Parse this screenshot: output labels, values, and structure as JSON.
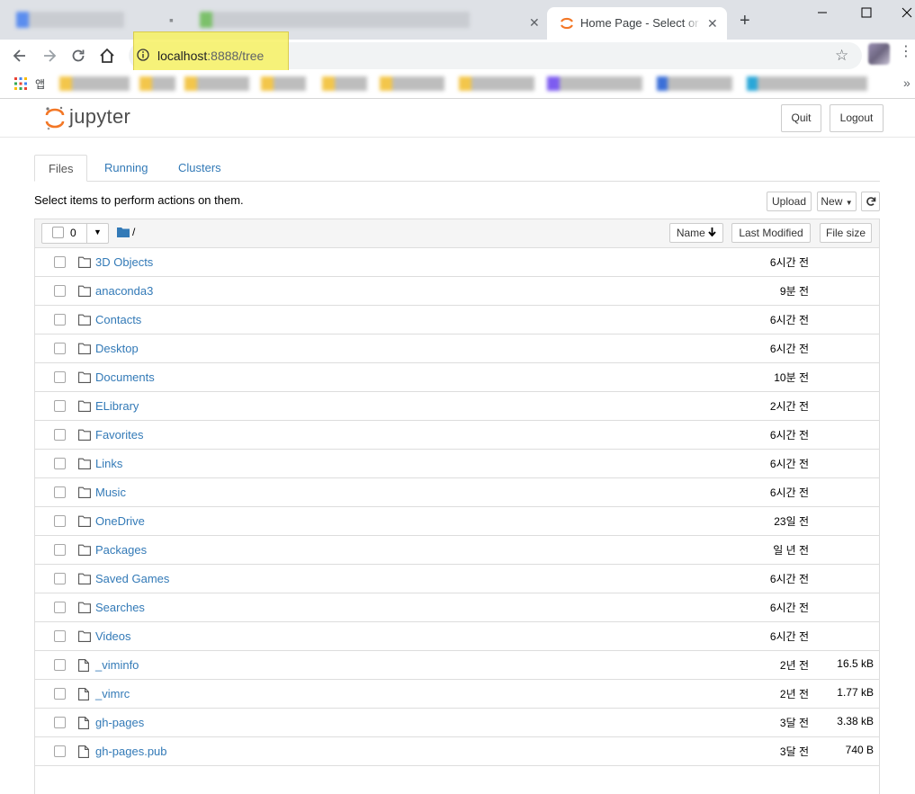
{
  "browser": {
    "active_tab_title": "Home Page - Select or create a notebook",
    "new_tab_glyph": "+",
    "close_glyph": "✕",
    "url_host": "localhost",
    "url_rest": ":8888/tree",
    "apps_label": "앱",
    "bookmarks_more": "»"
  },
  "header": {
    "logo_text": "jupyter",
    "quit_label": "Quit",
    "logout_label": "Logout"
  },
  "tabs": [
    {
      "label": "Files",
      "active": true
    },
    {
      "label": "Running",
      "active": false
    },
    {
      "label": "Clusters",
      "active": false
    }
  ],
  "toolbar": {
    "hint": "Select items to perform actions on them.",
    "upload_label": "Upload",
    "new_label": "New"
  },
  "listing": {
    "selected_count": "0",
    "breadcrumb": "/",
    "col_name": "Name",
    "col_modified": "Last Modified",
    "col_size": "File size",
    "items": [
      {
        "type": "folder",
        "name": "3D Objects",
        "modified": "6시간 전",
        "size": ""
      },
      {
        "type": "folder",
        "name": "anaconda3",
        "modified": "9분 전",
        "size": ""
      },
      {
        "type": "folder",
        "name": "Contacts",
        "modified": "6시간 전",
        "size": ""
      },
      {
        "type": "folder",
        "name": "Desktop",
        "modified": "6시간 전",
        "size": ""
      },
      {
        "type": "folder",
        "name": "Documents",
        "modified": "10분 전",
        "size": ""
      },
      {
        "type": "folder",
        "name": "ELibrary",
        "modified": "2시간 전",
        "size": ""
      },
      {
        "type": "folder",
        "name": "Favorites",
        "modified": "6시간 전",
        "size": ""
      },
      {
        "type": "folder",
        "name": "Links",
        "modified": "6시간 전",
        "size": ""
      },
      {
        "type": "folder",
        "name": "Music",
        "modified": "6시간 전",
        "size": ""
      },
      {
        "type": "folder",
        "name": "OneDrive",
        "modified": "23일 전",
        "size": ""
      },
      {
        "type": "folder",
        "name": "Packages",
        "modified": "일 년 전",
        "size": ""
      },
      {
        "type": "folder",
        "name": "Saved Games",
        "modified": "6시간 전",
        "size": ""
      },
      {
        "type": "folder",
        "name": "Searches",
        "modified": "6시간 전",
        "size": ""
      },
      {
        "type": "folder",
        "name": "Videos",
        "modified": "6시간 전",
        "size": ""
      },
      {
        "type": "file",
        "name": "_viminfo",
        "modified": "2년 전",
        "size": "16.5 kB"
      },
      {
        "type": "file",
        "name": "_vimrc",
        "modified": "2년 전",
        "size": "1.77 kB"
      },
      {
        "type": "file",
        "name": "gh-pages",
        "modified": "3달 전",
        "size": "3.38 kB"
      },
      {
        "type": "file",
        "name": "gh-pages.pub",
        "modified": "3달 전",
        "size": "740 B"
      }
    ]
  },
  "colors": {
    "link": "#337ab7",
    "jupyter_orange": "#f37726",
    "highlight": "#f7f264"
  }
}
